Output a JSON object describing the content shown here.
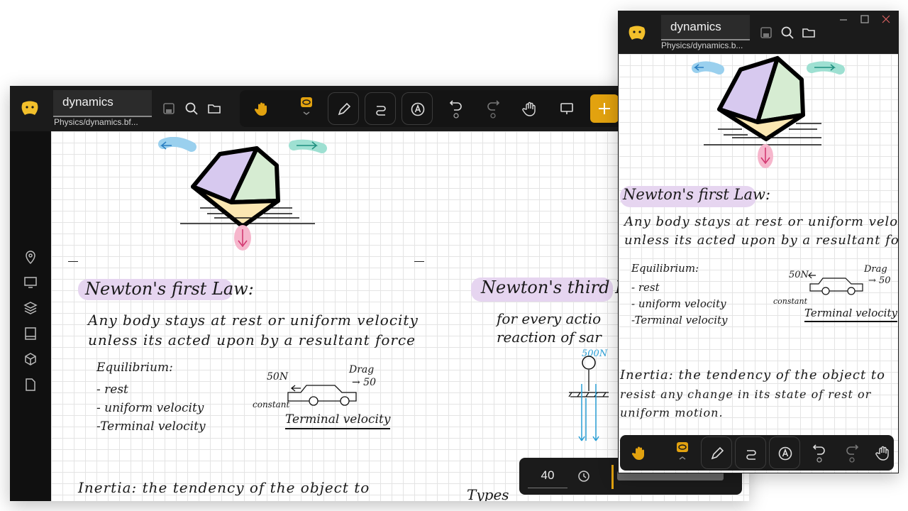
{
  "main": {
    "title": "dynamics",
    "path": "Physics/dynamics.bf...",
    "zoom": "40",
    "accent": "#e2a20f"
  },
  "side": {
    "title": "dynamics",
    "path": "Physics/dynamics.b..."
  },
  "note": {
    "heading1": "Newton's first Law:",
    "line1": "Any body stays at rest or uniform velocity",
    "line2": "unless its acted upon by a resultant force",
    "equilibrium": "Equilibrium:",
    "eq_items": [
      "- rest",
      "- uniform velocity",
      "-Terminal velocity"
    ],
    "force": "50N",
    "drag": "Drag",
    "drag_val": "→ 50",
    "constant": "constant",
    "terminal": "Terminal velocity",
    "inertia1": "Inertia: the tendency of the object to",
    "inertia2": "resist any change in its state of rest or",
    "inertia3": "uniform motion.",
    "heading3": "Newton's third La",
    "third1": "for every actio",
    "third2": "reaction of sar",
    "third_force": "500N",
    "types": "Types"
  },
  "side_note": {
    "heading1": "Newton's first Law:",
    "line1": "Any body stays at rest or uniform veloci",
    "line2": "unless its acted upon by a resultant fo",
    "drag_val": "→ 50"
  },
  "icons": {
    "rail": [
      "location-pin-icon",
      "monitor-icon",
      "layers-icon",
      "book-icon",
      "cube-icon",
      "file-icon"
    ]
  }
}
